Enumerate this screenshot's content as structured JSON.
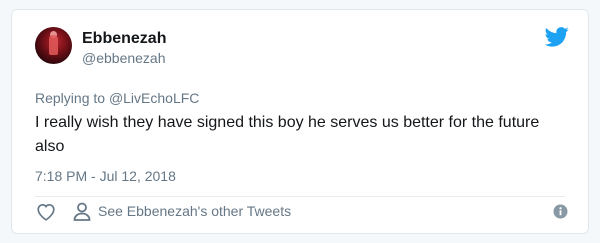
{
  "tweet": {
    "author_name": "Ebbenezah",
    "author_handle": "@ebbenezah",
    "replying_prefix": "Replying to ",
    "replying_to": "@LivEchoLFC",
    "text": "I really wish they have signed this boy he serves us better for the future also",
    "timestamp": "7:18 PM - Jul 12, 2018"
  },
  "actions": {
    "other_tweets_label": "See Ebbenezah's other Tweets",
    "like_icon": "heart-icon",
    "profile_icon": "person-icon",
    "info_icon": "info-icon"
  },
  "colors": {
    "twitter_blue": "#1da1f2",
    "secondary_text": "#657786",
    "primary_text": "#14171a"
  }
}
